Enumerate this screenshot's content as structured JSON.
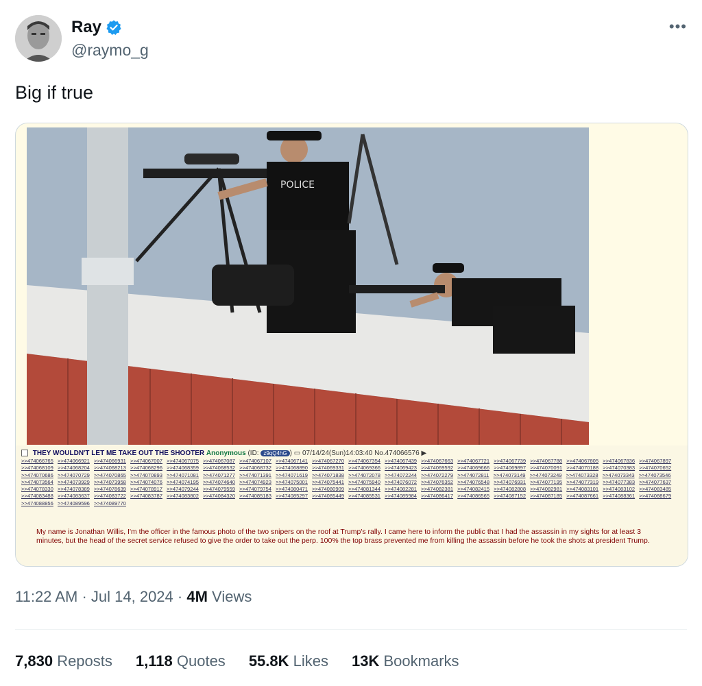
{
  "author": {
    "name": "Ray",
    "handle": "@raymo_g"
  },
  "tweet": {
    "text": "Big if true"
  },
  "media": {
    "photo_label": "POLICE",
    "post": {
      "subject": "THEY WOULDN'T LET ME TAKE OUT THE SHOOTER",
      "poster": "Anonymous",
      "id_prefix": "(ID:",
      "id_value": "z9qQ4hG",
      "id_suffix": ")",
      "datetime": "07/14/24(Sun)14:03:40",
      "number": "No.474066576",
      "replies": [
        ">>474066765",
        ">>474066921",
        ">>474066931",
        ">>474067007",
        ">>474067075",
        ">>474067087",
        ">>474067107",
        ">>474067141",
        ">>474067270",
        ">>474067354",
        ">>474067439",
        ">>474067663",
        ">>474067721",
        ">>474067739",
        ">>474067788",
        ">>474067805",
        ">>474067836",
        ">>474067897",
        ">>474068109",
        ">>474068204",
        ">>474068213",
        ">>474068296",
        ">>474068359",
        ">>474068532",
        ">>474068732",
        ">>474068890",
        ">>474069331",
        ">>474069366",
        ">>474069423",
        ">>474069592",
        ">>474069666",
        ">>474069897",
        ">>474070091",
        ">>474070188",
        ">>474070383",
        ">>474070652",
        ">>474070686",
        ">>474070729",
        ">>474070865",
        ">>474070893",
        ">>474071081",
        ">>474071277",
        ">>474071391",
        ">>474071619",
        ">>474071838",
        ">>474072078",
        ">>474072244",
        ">>474072279",
        ">>474072811",
        ">>474073149",
        ">>474073249",
        ">>474073328",
        ">>474073343",
        ">>474073546",
        ">>474073564",
        ">>474073929",
        ">>474073958",
        ">>474074076",
        ">>474074195",
        ">>474074640",
        ">>474074923",
        ">>474075001",
        ">>474075441",
        ">>474075940",
        ">>474076072",
        ">>474076352",
        ">>474076548",
        ">>474076931",
        ">>474077195",
        ">>474077319",
        ">>474077383",
        ">>474077637",
        ">>474078330",
        ">>474078389",
        ">>474078639",
        ">>474078917",
        ">>474079244",
        ">>474079559",
        ">>474079754",
        ">>474080471",
        ">>474080909",
        ">>474081344",
        ">>474082281",
        ">>474082381",
        ">>474082415",
        ">>474082808",
        ">>474082981",
        ">>474083101",
        ">>474083102",
        ">>474083485",
        ">>474083488",
        ">>474083637",
        ">>474083722",
        ">>474083787",
        ">>474083802",
        ">>474084320",
        ">>474085183",
        ">>474085297",
        ">>474085449",
        ">>474085531",
        ">>474085984",
        ">>474086417",
        ">>474086565",
        ">>474087152",
        ">>474087185",
        ">>474087661",
        ">>474088361",
        ">>474088679",
        ">>474088856",
        ">>474089596",
        ">>474089770"
      ],
      "comment": "My name is Jonathan Willis, I'm the officer in the famous photo of the two snipers on the roof at Trump's rally. I came here to inform the public that I had the assassin in my sights for at least 3 minutes, but the head of the secret service refused to give the order to take out the perp. 100% the top brass prevented me from killing the assassin before he took the shots at president Trump."
    }
  },
  "meta": {
    "time": "11:22 AM",
    "separator": "·",
    "date": "Jul 14, 2024",
    "views_count": "4M",
    "views_label": "Views"
  },
  "stats": {
    "reposts_count": "7,830",
    "reposts_label": "Reposts",
    "quotes_count": "1,118",
    "quotes_label": "Quotes",
    "likes_count": "55.8K",
    "likes_label": "Likes",
    "bookmarks_count": "13K",
    "bookmarks_label": "Bookmarks"
  },
  "colors": {
    "verified": "#1d9bf0",
    "text_secondary": "#536471",
    "post_background": "#fbf7e4",
    "roof_siding": "#b34a3a"
  }
}
